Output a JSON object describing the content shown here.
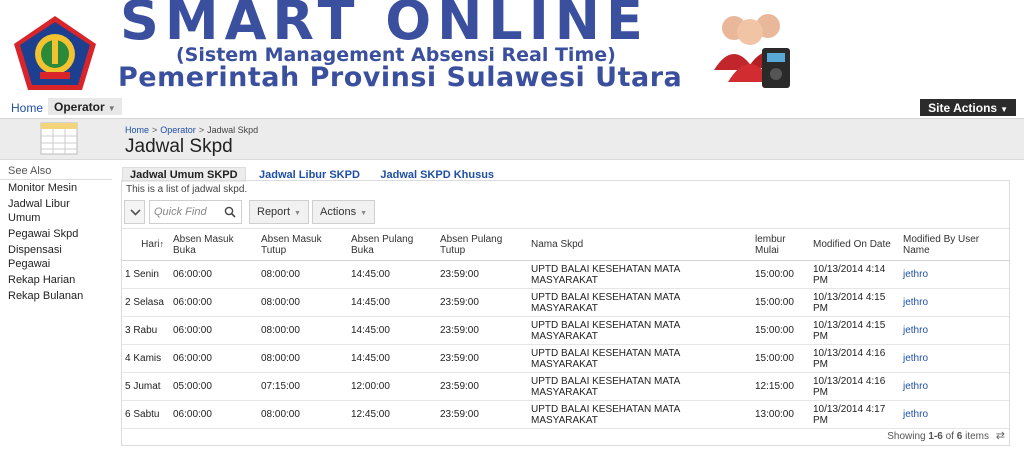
{
  "banner": {
    "title": "SMART ONLINE",
    "subtitle": "(Sistem Management Absensi Real Time)",
    "org": "Pemerintah Provinsi Sulawesi Utara"
  },
  "topnav": {
    "home": "Home",
    "operator": "Operator",
    "site_actions": "Site Actions"
  },
  "breadcrumb": {
    "home": "Home",
    "operator": "Operator",
    "current": "Jadwal Skpd",
    "separator": ">"
  },
  "page_title": "Jadwal Skpd",
  "sidebar": {
    "heading": "See Also",
    "items": [
      "Monitor Mesin",
      "Jadwal Libur Umum",
      "Pegawai Skpd",
      "Dispensasi Pegawai",
      "Rekap Harian",
      "Rekap Bulanan"
    ]
  },
  "tabs": [
    "Jadwal Umum SKPD",
    "Jadwal Libur SKPD",
    "Jadwal SKPD Khusus"
  ],
  "description": "This is a list of jadwal skpd.",
  "toolbar": {
    "search_placeholder": "Quick Find",
    "report": "Report",
    "actions": "Actions"
  },
  "table": {
    "headers": {
      "hari": "Hari",
      "masuk_buka": "Absen Masuk Buka",
      "masuk_tutup": "Absen Masuk Tutup",
      "pulang_buka": "Absen Pulang Buka",
      "pulang_tutup": "Absen Pulang Tutup",
      "nama_skpd": "Nama Skpd",
      "lembur": "lembur Mulai",
      "modified_on": "Modified On Date",
      "modified_by": "Modified By User Name"
    },
    "rows": [
      {
        "hari": "1 Senin",
        "masuk_buka": "06:00:00",
        "masuk_tutup": "08:00:00",
        "pulang_buka": "14:45:00",
        "pulang_tutup": "23:59:00",
        "nama_skpd": "UPTD BALAI KESEHATAN MATA MASYARAKAT",
        "lembur": "15:00:00",
        "modified_on": "10/13/2014 4:14 PM",
        "modified_by": "jethro"
      },
      {
        "hari": "2 Selasa",
        "masuk_buka": "06:00:00",
        "masuk_tutup": "08:00:00",
        "pulang_buka": "14:45:00",
        "pulang_tutup": "23:59:00",
        "nama_skpd": "UPTD BALAI KESEHATAN MATA MASYARAKAT",
        "lembur": "15:00:00",
        "modified_on": "10/13/2014 4:15 PM",
        "modified_by": "jethro"
      },
      {
        "hari": "3 Rabu",
        "masuk_buka": "06:00:00",
        "masuk_tutup": "08:00:00",
        "pulang_buka": "14:45:00",
        "pulang_tutup": "23:59:00",
        "nama_skpd": "UPTD BALAI KESEHATAN MATA MASYARAKAT",
        "lembur": "15:00:00",
        "modified_on": "10/13/2014 4:15 PM",
        "modified_by": "jethro"
      },
      {
        "hari": "4 Kamis",
        "masuk_buka": "06:00:00",
        "masuk_tutup": "08:00:00",
        "pulang_buka": "14:45:00",
        "pulang_tutup": "23:59:00",
        "nama_skpd": "UPTD BALAI KESEHATAN MATA MASYARAKAT",
        "lembur": "15:00:00",
        "modified_on": "10/13/2014 4:16 PM",
        "modified_by": "jethro"
      },
      {
        "hari": "5 Jumat",
        "masuk_buka": "05:00:00",
        "masuk_tutup": "07:15:00",
        "pulang_buka": "12:00:00",
        "pulang_tutup": "23:59:00",
        "nama_skpd": "UPTD BALAI KESEHATAN MATA MASYARAKAT",
        "lembur": "12:15:00",
        "modified_on": "10/13/2014 4:16 PM",
        "modified_by": "jethro"
      },
      {
        "hari": "6 Sabtu",
        "masuk_buka": "06:00:00",
        "masuk_tutup": "08:00:00",
        "pulang_buka": "12:45:00",
        "pulang_tutup": "23:59:00",
        "nama_skpd": "UPTD BALAI KESEHATAN MATA MASYARAKAT",
        "lembur": "13:00:00",
        "modified_on": "10/13/2014 4:17 PM",
        "modified_by": "jethro"
      }
    ]
  },
  "footer": {
    "prefix": "Showing",
    "range": "1-6",
    "middle": "of",
    "total": "6",
    "suffix": "items"
  },
  "icons": {
    "emblem": "provincial-emblem-icon",
    "people": "people-fingerprint-icon",
    "page": "table-page-icon",
    "search": "search-icon",
    "chevron": "chevron-down-icon",
    "refresh": "refresh-icon"
  },
  "colors": {
    "brand": "#3a4f9e",
    "link": "#1f4fa6",
    "site_actions_bg": "#2b2b2b"
  }
}
